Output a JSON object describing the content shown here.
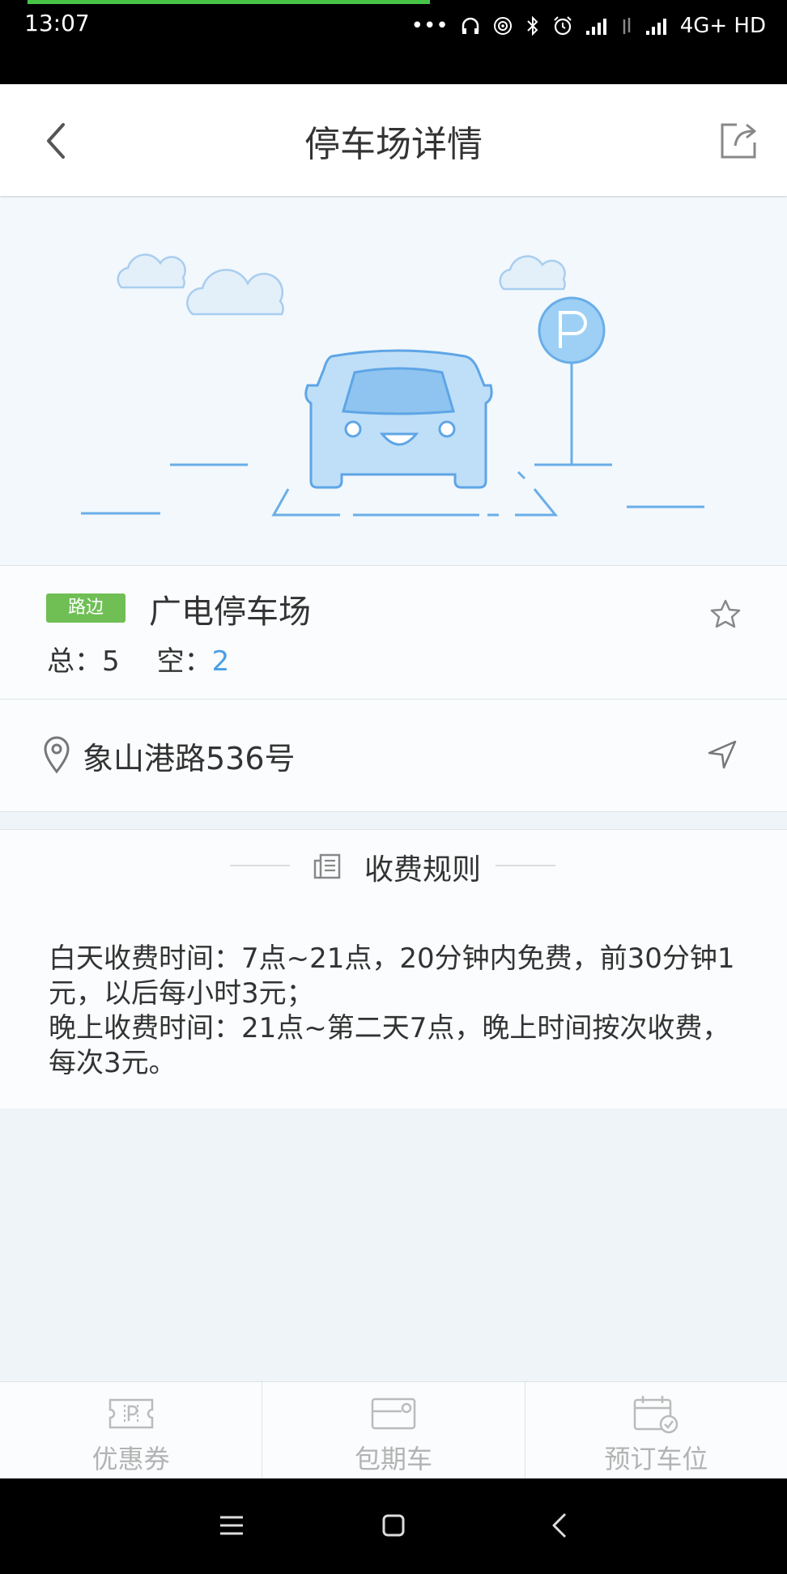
{
  "status_bar": {
    "time": "13:07",
    "network": "4G+ HD"
  },
  "header": {
    "title": "停车场详情"
  },
  "lot": {
    "type_badge": "路边",
    "name": "广电停车场",
    "total_label": "总：",
    "total_value": "5",
    "free_label": "空：",
    "free_value": "2"
  },
  "address": {
    "text": "象山港路536号"
  },
  "fee": {
    "section_title": "收费规则",
    "lines": [
      "白天收费时间：7点~21点，20分钟内免费，前30分钟1元，以后每小时3元；",
      "晚上收费时间：21点~第二天7点，晚上时间按次收费，每次3元。"
    ]
  },
  "tabs": [
    {
      "label": "优惠券",
      "icon": "coupon-icon"
    },
    {
      "label": "包期车",
      "icon": "card-icon"
    },
    {
      "label": "预订车位",
      "icon": "calendar-check-icon"
    }
  ],
  "colors": {
    "accent_blue": "#4a9fe6",
    "badge_green": "#6fbf55",
    "progress_green": "#47c447"
  }
}
